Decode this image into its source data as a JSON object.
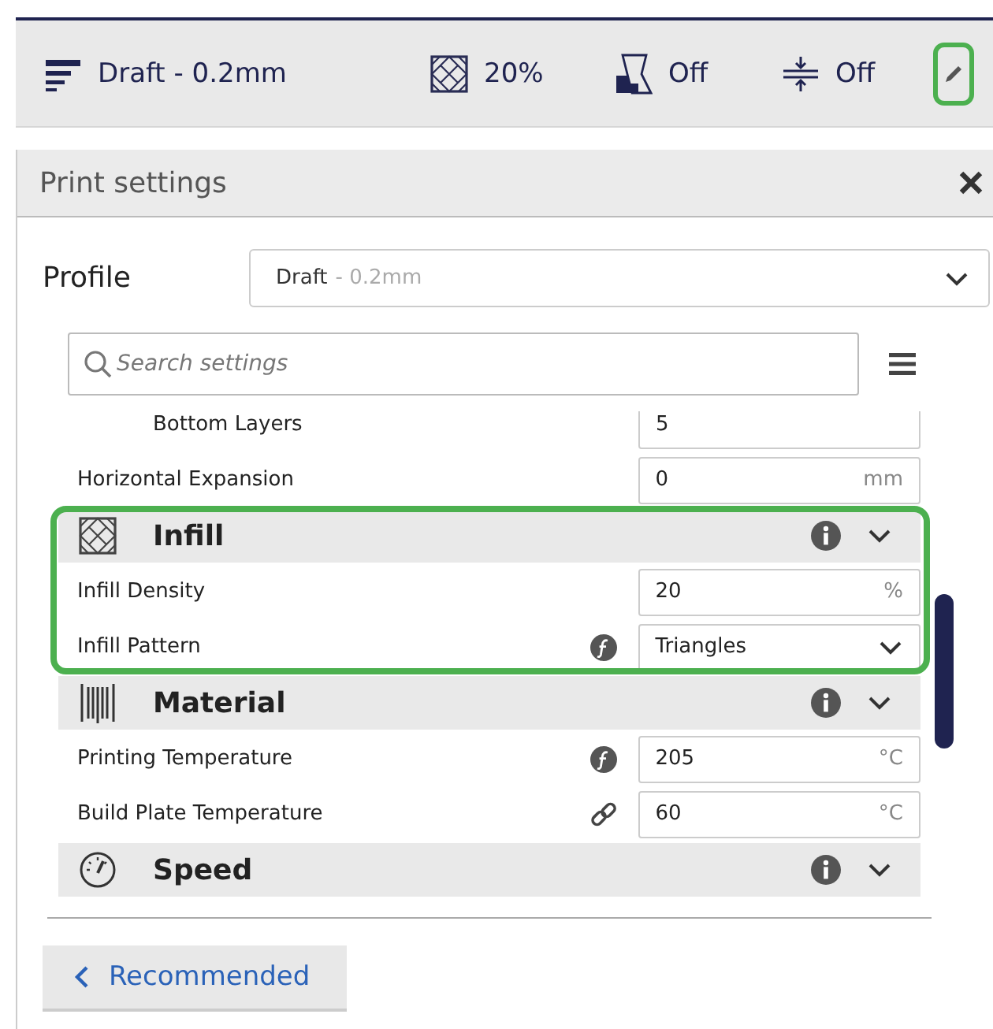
{
  "toolbar": {
    "items": [
      {
        "kind": "profile",
        "text": "Draft - 0.2mm"
      },
      {
        "kind": "infill",
        "text": "20%"
      },
      {
        "kind": "support",
        "text": "Off"
      },
      {
        "kind": "adhesion",
        "text": "Off"
      }
    ],
    "edit_button": {
      "highlighted": true
    }
  },
  "panel": {
    "title": "Print settings",
    "profile": {
      "label": "Profile",
      "name": "Draft",
      "detail": "- 0.2mm"
    },
    "search": {
      "placeholder": "Search settings"
    },
    "settings": [
      {
        "kind": "group",
        "children": [
          {
            "kind": "field",
            "label": "Bottom Layers",
            "value": "5"
          }
        ]
      },
      {
        "kind": "field",
        "label": "Horizontal Expansion",
        "value": "0",
        "unit": "mm"
      },
      {
        "kind": "infill",
        "title": "Infill",
        "highlighted": true,
        "expanded": true,
        "children": [
          {
            "kind": "field",
            "label": "Infill Density",
            "value": "20",
            "unit": "%"
          },
          {
            "kind": "select",
            "label": "Infill Pattern",
            "value": "Triangles",
            "badge": {
              "kind": "function"
            }
          }
        ]
      },
      {
        "kind": "material",
        "title": "Material",
        "highlighted": false,
        "expanded": true,
        "children": [
          {
            "kind": "field",
            "label": "Printing Temperature",
            "value": "205",
            "unit": "°C",
            "badge": {
              "kind": "function"
            }
          },
          {
            "kind": "field",
            "label": "Build Plate Temperature",
            "value": "60",
            "unit": "°C",
            "badge": {
              "kind": "link"
            }
          }
        ]
      },
      {
        "kind": "speed",
        "title": "Speed",
        "highlighted": false,
        "expanded": true
      }
    ]
  },
  "footer": {
    "button": {
      "label": "Recommended"
    }
  }
}
